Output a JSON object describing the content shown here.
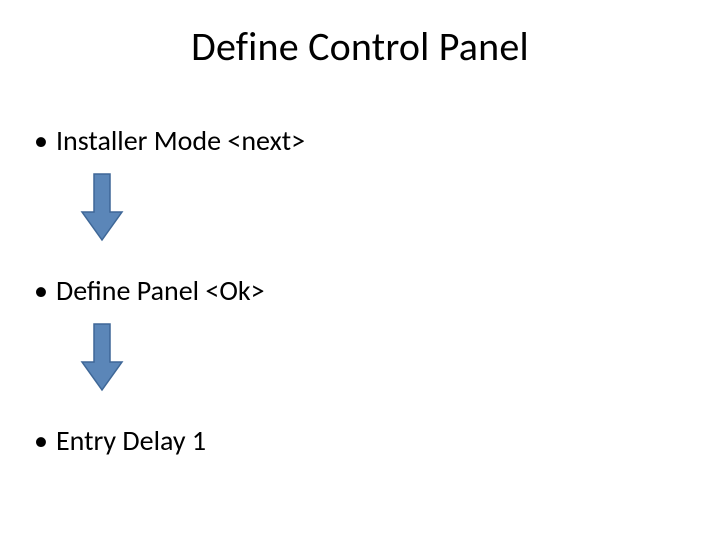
{
  "title": "Define Control Panel",
  "bullets": [
    "Installer Mode  <next>",
    "Define Panel  <Ok>",
    "Entry Delay 1"
  ],
  "arrow": {
    "fill": "#5b86b8",
    "stroke": "#3e6797"
  }
}
